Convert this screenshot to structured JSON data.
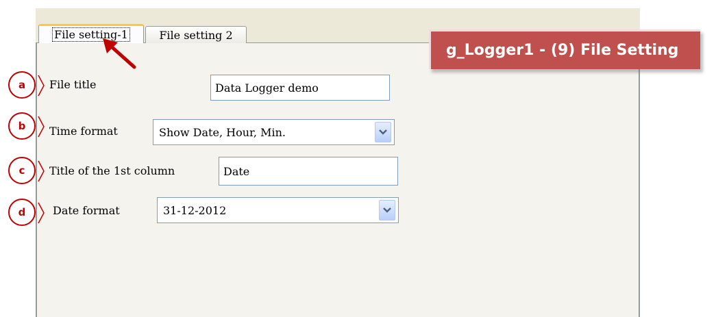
{
  "tabs": [
    {
      "label": "File setting-1"
    },
    {
      "label": "File setting 2"
    }
  ],
  "banner": {
    "title": "g_Logger1 - (9) File Setting"
  },
  "markers": [
    "a",
    "b",
    "c",
    "d"
  ],
  "form": {
    "file_title": {
      "label": "File title",
      "value": "Data Logger demo"
    },
    "time_format": {
      "label": "Time format",
      "selected": "Show Date, Hour, Min."
    },
    "first_column": {
      "label": "Title of the 1st column",
      "value": "Date"
    },
    "date_format": {
      "label": "Date format",
      "selected": "31-12-2012"
    }
  },
  "colors": {
    "marker": "#c00000",
    "banner": "#c0504d",
    "tab_highlight": "#ffc83c"
  }
}
